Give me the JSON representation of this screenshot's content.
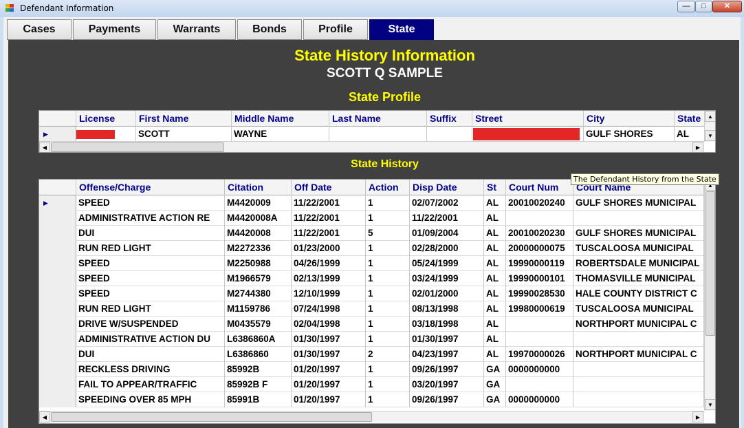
{
  "window": {
    "title": "Defendant Information"
  },
  "tabs": [
    "Cases",
    "Payments",
    "Warrants",
    "Bonds",
    "Profile",
    "State"
  ],
  "panel": {
    "title": "State History Information",
    "name": "SCOTT Q SAMPLE",
    "profile_title": "State Profile",
    "history_title": "State History"
  },
  "profile": {
    "columns": [
      "License",
      "First Name",
      "Middle Name",
      "Last Name",
      "Suffix",
      "Street",
      "City",
      "State"
    ],
    "row": [
      "",
      "SCOTT",
      "WAYNE",
      "",
      "",
      "",
      "GULF SHORES",
      "AL"
    ]
  },
  "history": {
    "columns": [
      "Offense/Charge",
      "Citation",
      "Off Date",
      "Action",
      "Disp Date",
      "St",
      "Court Num",
      "Court Name"
    ],
    "rows": [
      [
        "SPEED",
        "M4420009",
        "11/22/2001",
        "1",
        "02/07/2002",
        "AL",
        "20010020240",
        "GULF SHORES MUNICIPAL"
      ],
      [
        "ADMINISTRATIVE ACTION RE",
        "M4420008A",
        "11/22/2001",
        "1",
        "11/22/2001",
        "AL",
        "",
        ""
      ],
      [
        "DUI",
        "M4420008",
        "11/22/2001",
        "5",
        "01/09/2004",
        "AL",
        "20010020230",
        "GULF SHORES MUNICIPAL"
      ],
      [
        "RUN RED LIGHT",
        "M2272336",
        "01/23/2000",
        "1",
        "02/28/2000",
        "AL",
        "20000000075",
        "TUSCALOOSA MUNICIPAL"
      ],
      [
        "SPEED",
        "M2250988",
        "04/26/1999",
        "1",
        "05/24/1999",
        "AL",
        "19990000119",
        "ROBERTSDALE MUNICIPAL"
      ],
      [
        "SPEED",
        "M1966579",
        "02/13/1999",
        "1",
        "03/24/1999",
        "AL",
        "19990000101",
        "THOMASVILLE MUNICIPAL"
      ],
      [
        "SPEED",
        "M2744380",
        "12/10/1999",
        "1",
        "02/01/2000",
        "AL",
        "19990028530",
        "HALE COUNTY DISTRICT C"
      ],
      [
        "RUN RED LIGHT",
        "M1159786",
        "07/24/1998",
        "1",
        "08/13/1998",
        "AL",
        "19980000619",
        "TUSCALOOSA MUNICIPAL"
      ],
      [
        "DRIVE W/SUSPENDED",
        "M0435579",
        "02/04/1998",
        "1",
        "03/18/1998",
        "AL",
        "",
        "NORTHPORT MUNICIPAL C"
      ],
      [
        "ADMINISTRATIVE ACTION DU",
        "L6386860A",
        "01/30/1997",
        "1",
        "01/30/1997",
        "AL",
        "",
        ""
      ],
      [
        "DUI",
        "L6386860",
        "01/30/1997",
        "2",
        "04/23/1997",
        "AL",
        "19970000026",
        "NORTHPORT MUNICIPAL C"
      ],
      [
        "RECKLESS DRIVING",
        "85992B",
        "01/20/1997",
        "1",
        "09/26/1997",
        "GA",
        "0000000000",
        ""
      ],
      [
        "FAIL TO APPEAR/TRAFFIC",
        "85992B  F",
        "01/20/1997",
        "1",
        "03/20/1997",
        "GA",
        "",
        ""
      ],
      [
        "SPEEDING OVER 85 MPH",
        "85991B",
        "01/20/1997",
        "1",
        "09/26/1997",
        "GA",
        "0000000000",
        ""
      ]
    ]
  },
  "tooltip": "The Defendant History from the State",
  "colors": {
    "heading": "#ffff00",
    "panel": "#404040",
    "active_tab": "#000080",
    "redaction": "#e32626"
  }
}
